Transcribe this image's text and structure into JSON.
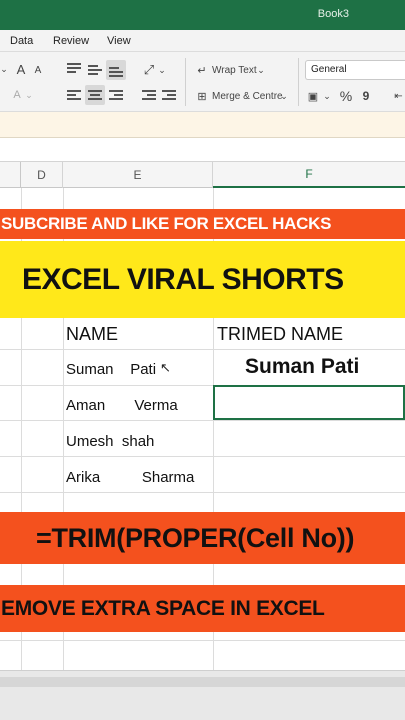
{
  "window": {
    "title": "Book3"
  },
  "ribbon_tabs": [
    "Data",
    "Review",
    "View"
  ],
  "ribbon": {
    "font_size_up": "A",
    "font_size_down": "A",
    "font_color": "A",
    "wrap_text_label": "Wrap Text",
    "merge_center_label": "Merge & Centre",
    "number_format_value": "General",
    "percent_symbol": "%",
    "comma_symbol": "9"
  },
  "columns": [
    "D",
    "E",
    "F"
  ],
  "selected_column": "F",
  "banners": {
    "subscribe": "SUBCRIBE AND LIKE FOR EXCEL HACKS",
    "title": "EXCEL VIRAL SHORTS",
    "formula": "=TRIM(PROPER(Cell No))",
    "remove": "EMOVE EXTRA SPACE IN EXCEL"
  },
  "table": {
    "header_name": "NAME",
    "header_trimmed": "TRIMED NAME",
    "rows": [
      {
        "name": "Suman    Pati",
        "trimmed": "Suman Pati"
      },
      {
        "name": "Aman       Verma",
        "trimmed": ""
      },
      {
        "name": "Umesh  shah",
        "trimmed": ""
      },
      {
        "name": "Arika          Sharma",
        "trimmed": ""
      }
    ]
  },
  "colors": {
    "excel_green": "#1e7145",
    "banner_orange": "#f4511e",
    "banner_yellow": "#ffe81a"
  }
}
